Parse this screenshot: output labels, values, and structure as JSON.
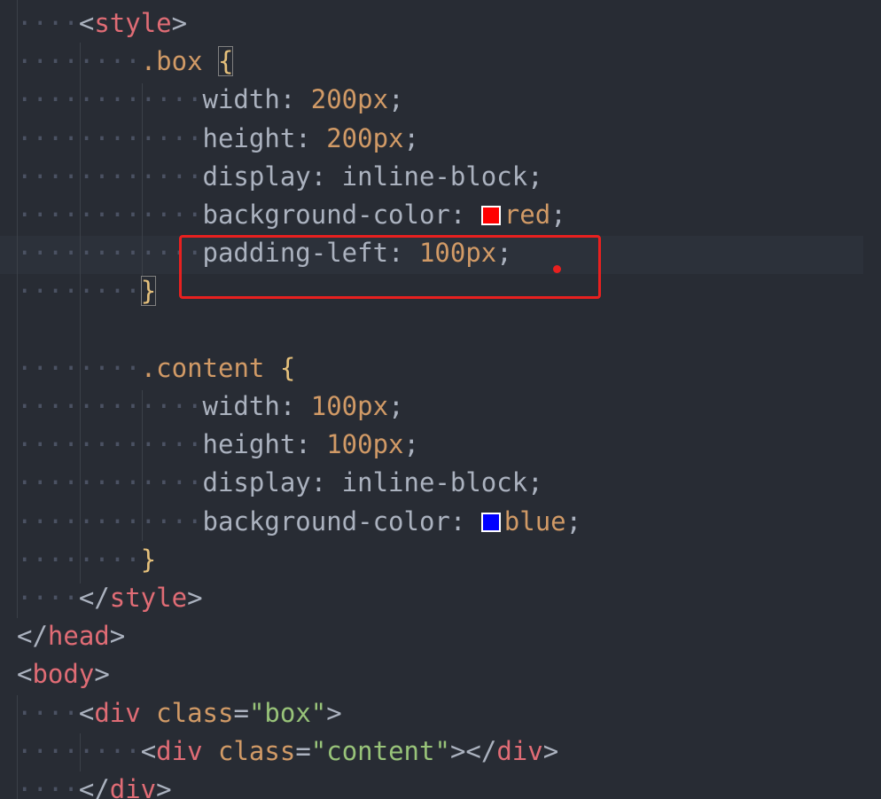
{
  "editor": {
    "lines": [
      {
        "indent": "····",
        "parts": [
          [
            "punc",
            "<"
          ],
          [
            "tag",
            "style"
          ],
          [
            "punc",
            ">"
          ]
        ]
      },
      {
        "indent": "········",
        "parts": [
          [
            "sel",
            ".box"
          ],
          [
            "punc",
            " "
          ],
          [
            "brace match",
            "{"
          ]
        ]
      },
      {
        "indent": "············",
        "parts": [
          [
            "prop",
            "width"
          ],
          [
            "punc",
            ": "
          ],
          [
            "num",
            "200px"
          ],
          [
            "punc",
            ";"
          ]
        ]
      },
      {
        "indent": "············",
        "parts": [
          [
            "prop",
            "height"
          ],
          [
            "punc",
            ": "
          ],
          [
            "num",
            "200px"
          ],
          [
            "punc",
            ";"
          ]
        ]
      },
      {
        "indent": "············",
        "parts": [
          [
            "prop",
            "display"
          ],
          [
            "punc",
            ": "
          ],
          [
            "val",
            "inline-block"
          ],
          [
            "punc",
            ";"
          ]
        ]
      },
      {
        "indent": "············",
        "parts": [
          [
            "prop",
            "background-color"
          ],
          [
            "punc",
            ": "
          ],
          [
            "swatch",
            "#ff0000"
          ],
          [
            "cval",
            "red"
          ],
          [
            "punc",
            ";"
          ]
        ]
      },
      {
        "indent": "············",
        "parts": [
          [
            "prop",
            "padding-left"
          ],
          [
            "punc",
            ": "
          ],
          [
            "num",
            "100px"
          ],
          [
            "punc",
            ";"
          ]
        ]
      },
      {
        "indent": "········",
        "parts": [
          [
            "brace match",
            "}"
          ]
        ]
      },
      {
        "indent": "",
        "parts": []
      },
      {
        "indent": "········",
        "parts": [
          [
            "sel",
            ".content"
          ],
          [
            "punc",
            " "
          ],
          [
            "brace",
            "{"
          ]
        ]
      },
      {
        "indent": "············",
        "parts": [
          [
            "prop",
            "width"
          ],
          [
            "punc",
            ": "
          ],
          [
            "num",
            "100px"
          ],
          [
            "punc",
            ";"
          ]
        ]
      },
      {
        "indent": "············",
        "parts": [
          [
            "prop",
            "height"
          ],
          [
            "punc",
            ": "
          ],
          [
            "num",
            "100px"
          ],
          [
            "punc",
            ";"
          ]
        ]
      },
      {
        "indent": "············",
        "parts": [
          [
            "prop",
            "display"
          ],
          [
            "punc",
            ": "
          ],
          [
            "val",
            "inline-block"
          ],
          [
            "punc",
            ";"
          ]
        ]
      },
      {
        "indent": "············",
        "parts": [
          [
            "prop",
            "background-color"
          ],
          [
            "punc",
            ": "
          ],
          [
            "swatch",
            "#0000ff"
          ],
          [
            "cval",
            "blue"
          ],
          [
            "punc",
            ";"
          ]
        ]
      },
      {
        "indent": "········",
        "parts": [
          [
            "brace",
            "}"
          ]
        ]
      },
      {
        "indent": "····",
        "parts": [
          [
            "punc",
            "</"
          ],
          [
            "tag",
            "style"
          ],
          [
            "punc",
            ">"
          ]
        ]
      },
      {
        "indent": "",
        "parts": [
          [
            "punc",
            "</"
          ],
          [
            "tag",
            "head"
          ],
          [
            "punc",
            ">"
          ]
        ]
      },
      {
        "indent": "",
        "parts": [
          [
            "punc",
            "<"
          ],
          [
            "tag",
            "body"
          ],
          [
            "punc",
            ">"
          ]
        ]
      },
      {
        "indent": "····",
        "parts": [
          [
            "punc",
            "<"
          ],
          [
            "tag",
            "div"
          ],
          [
            "punc",
            " "
          ],
          [
            "attr",
            "class"
          ],
          [
            "punc",
            "="
          ],
          [
            "str",
            "\"box\""
          ],
          [
            "punc",
            ">"
          ]
        ]
      },
      {
        "indent": "········",
        "parts": [
          [
            "punc",
            "<"
          ],
          [
            "tag",
            "div"
          ],
          [
            "punc",
            " "
          ],
          [
            "attr",
            "class"
          ],
          [
            "punc",
            "="
          ],
          [
            "str",
            "\"content\""
          ],
          [
            "punc",
            "></"
          ],
          [
            "tag",
            "div"
          ],
          [
            "punc",
            ">"
          ]
        ]
      },
      {
        "indent": "····",
        "parts": [
          [
            "punc",
            "</"
          ],
          [
            "tag",
            "div"
          ],
          [
            "punc",
            ">"
          ]
        ]
      }
    ],
    "colors": {
      "background": "#282c34",
      "current_line": "#2c313a",
      "annotation": "#e8201f",
      "swatch_red": "#ff0000",
      "swatch_blue": "#0000ff"
    },
    "annotation": {
      "target_line": "padding-left: 100px;",
      "shape": "rectangle-with-dot"
    }
  }
}
